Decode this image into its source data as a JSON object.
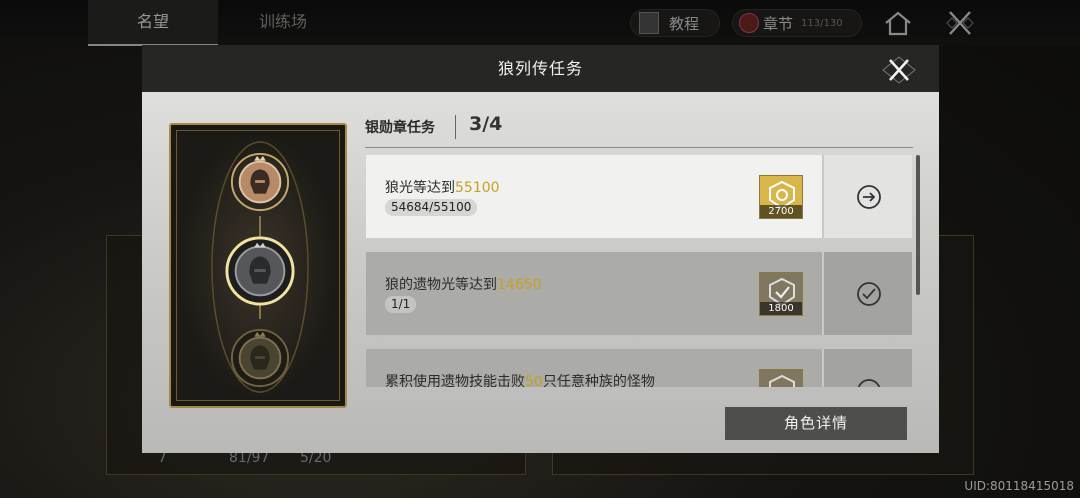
{
  "header": {
    "tabs": [
      {
        "label": "名望"
      },
      {
        "label": "训练场"
      }
    ],
    "tutorial_label": "教程",
    "chapter_label": "章节",
    "chapter_progress": "113/130"
  },
  "background": {
    "stats": [
      "7",
      "81/97",
      "5/20"
    ]
  },
  "modal": {
    "title": "狼列传任务",
    "section_title": "银勋章任务",
    "section_count": "3/4",
    "tasks": [
      {
        "prefix": "狼光等达到",
        "highlight": "55100",
        "suffix": "",
        "progress": "54684/55100",
        "reward_value": "2700",
        "action": "go",
        "selected": true
      },
      {
        "prefix": "狼的遗物光等达到",
        "highlight": "14650",
        "suffix": "",
        "progress": "1/1",
        "reward_value": "1800",
        "action": "done",
        "selected": false
      },
      {
        "prefix": "累积使用遗物技能击败",
        "highlight": "50",
        "suffix": "只任意种族的怪物",
        "progress": "",
        "reward_value": "",
        "action": "done",
        "selected": false
      }
    ],
    "detail_button": "角色详情"
  },
  "uid_text": "UID:80118415018",
  "colors": {
    "gold": "#c8a020",
    "accent_border": "#a88a45",
    "modal_header": "#262624"
  }
}
